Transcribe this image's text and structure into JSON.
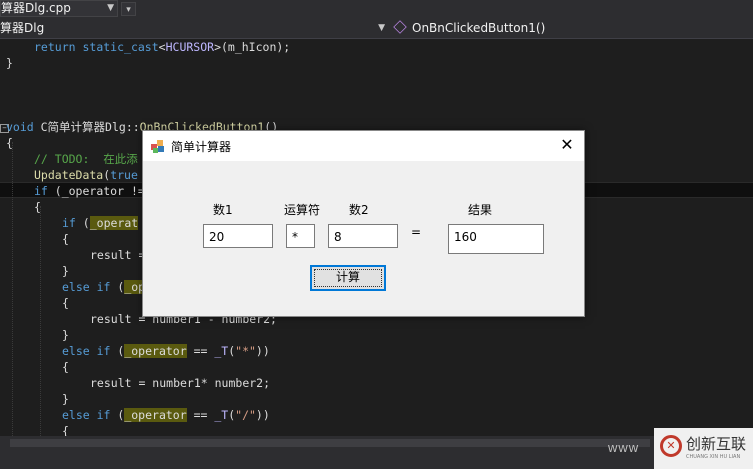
{
  "ide": {
    "file_tab": "算器Dlg.cpp",
    "class_combo": "算器Dlg",
    "method_combo": "OnBnClickedButton1()"
  },
  "code_lines": [
    {
      "t": "return static_cast<HCURSOR>(m_hIcon);"
    },
    {
      "t": "}"
    },
    {
      "t": "void C简单计算器Dlg::OnBnClickedButton1()"
    },
    {
      "t": "{"
    },
    {
      "t": "// TODO:  在此添"
    },
    {
      "t": "UpdateData(true"
    },
    {
      "t": "if (_operator !="
    },
    {
      "t": "{"
    },
    {
      "t": "if (_operat"
    },
    {
      "t": "{"
    },
    {
      "t": "result ="
    },
    {
      "t": "}"
    },
    {
      "t": "else if (_op"
    },
    {
      "t": "{"
    },
    {
      "t": "result = number1 - number2;"
    },
    {
      "t": "}"
    },
    {
      "t": "else if (_operator == _T(\"*\"))"
    },
    {
      "t": "{"
    },
    {
      "t": "result = number1* number2;"
    },
    {
      "t": "}"
    },
    {
      "t": "else if (_operator == _T(\"/\"))"
    },
    {
      "t": "{"
    }
  ],
  "dialog": {
    "title": "简单计算器",
    "label_num1": "数1",
    "label_operator": "运算符",
    "label_num2": "数2",
    "label_result": "结果",
    "equals": "=",
    "num1_value": "20",
    "operator_value": "*",
    "num2_value": "8",
    "result_value": "160",
    "calc_button": "计算",
    "close_symbol": "✕"
  },
  "watermark": {
    "www": "www",
    "brand": "创新互联",
    "sub": "CHUANG XIN HU LIAN"
  },
  "colors": {
    "editor_bg": "#1e1e1e",
    "keyword": "#569cd6",
    "comment": "#57a64a",
    "highlight": "#5a5a0f",
    "focus_border": "#0078d7"
  }
}
